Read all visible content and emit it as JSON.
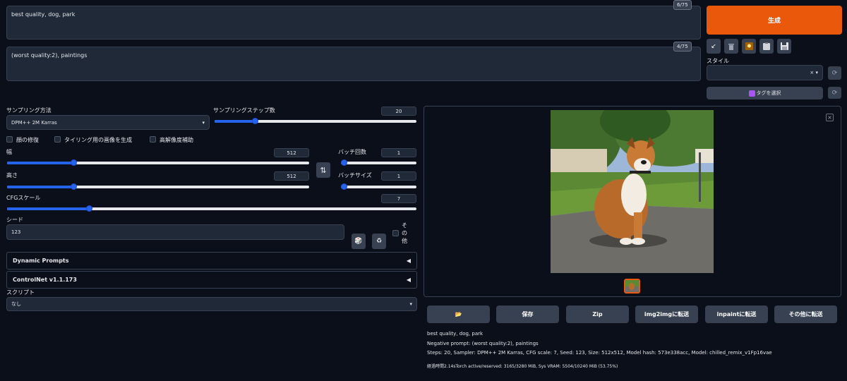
{
  "prompt": {
    "value": "best quality, dog, park",
    "counter": "6/75"
  },
  "negative_prompt": {
    "value": "(worst quality:2), paintings",
    "counter": "4/75"
  },
  "generate_label": "生成",
  "toolbar": {
    "restore_icon": "arrow-down-left-icon",
    "trash_icon": "trash-icon",
    "extra_icon": "picture-icon",
    "clipboard_icon": "clipboard-icon",
    "save_icon": "floppy-icon"
  },
  "style": {
    "label": "スタイル",
    "value": "",
    "clear": "×",
    "arrow": "▾"
  },
  "tag_button": "タグを選択",
  "sampling": {
    "label": "サンプリング方法",
    "value": "DPM++ 2M Karras",
    "arrow": "▾"
  },
  "steps": {
    "label": "サンプリングステップ数",
    "value": "20",
    "fraction": 0.2
  },
  "checkboxes": {
    "restore_faces": "顔の修復",
    "tiling": "タイリング用の画像を生成",
    "hires": "高解像度補助"
  },
  "width": {
    "label": "幅",
    "value": "512",
    "fraction": 0.22
  },
  "height": {
    "label": "高さ",
    "value": "512",
    "fraction": 0.22
  },
  "swap_icon": "⇅",
  "batch_count": {
    "label": "バッチ回数",
    "value": "1",
    "fraction": 0.0
  },
  "batch_size": {
    "label": "バッチサイズ",
    "value": "1",
    "fraction": 0.0
  },
  "cfg": {
    "label": "CFGスケール",
    "value": "7",
    "fraction": 0.2
  },
  "seed": {
    "label": "シード",
    "value": "123",
    "dice": "🎲",
    "recycle": "♻",
    "extra": "その他"
  },
  "dynamic_prompts": {
    "label": "Dynamic Prompts",
    "arrow": "◀"
  },
  "controlnet": {
    "label": "ControlNet v1.1.173",
    "arrow": "◀"
  },
  "script": {
    "label": "スクリプト",
    "value": "なし",
    "arrow": "▾"
  },
  "close_icon": "×",
  "actions": {
    "folder": "📂",
    "save": "保存",
    "zip": "Zip",
    "img2img": "img2imgに転送",
    "inpaint": "inpaintに転送",
    "other": "その他に転送"
  },
  "gen_info": {
    "line1": "best quality, dog, park",
    "line2": "Negative prompt: (worst quality:2), paintings",
    "line3": "Steps: 20, Sampler: DPM++ 2M Karras, CFG scale: 7, Seed: 123, Size: 512x512, Model hash: 573e338acc, Model: chilled_remix_v1Fp16vae",
    "line4": "経過時間2.14sTorch active/reserved: 3165/3280 MiB, Sys VRAM: 5504/10240 MiB (53.75%)"
  },
  "colors": {
    "accent": "#ea580c",
    "slider": "#2563eb",
    "bg": "#0b0f19"
  }
}
